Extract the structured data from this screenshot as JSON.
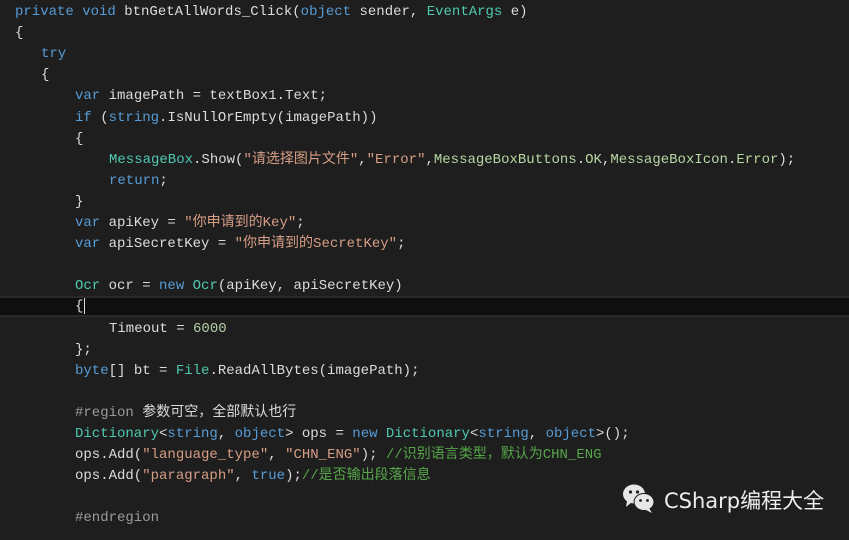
{
  "editor": {
    "current_line_index": 14,
    "lines": [
      {
        "indent": 0,
        "tokens": [
          [
            "kw",
            "private"
          ],
          [
            "plain",
            " "
          ],
          [
            "kw",
            "void"
          ],
          [
            "plain",
            " btnGetAllWords_Click("
          ],
          [
            "kw",
            "object"
          ],
          [
            "plain",
            " sender, "
          ],
          [
            "type",
            "EventArgs"
          ],
          [
            "plain",
            " e)"
          ]
        ]
      },
      {
        "indent": 0,
        "tokens": [
          [
            "plain",
            "{"
          ]
        ]
      },
      {
        "indent": 1,
        "tokens": [
          [
            "kw",
            "try"
          ]
        ]
      },
      {
        "indent": 1,
        "tokens": [
          [
            "plain",
            "{"
          ]
        ]
      },
      {
        "indent": 2,
        "tokens": [
          [
            "kw",
            "var"
          ],
          [
            "plain",
            " imagePath = textBox1.Text;"
          ]
        ]
      },
      {
        "indent": 2,
        "tokens": [
          [
            "kw",
            "if"
          ],
          [
            "plain",
            " ("
          ],
          [
            "kw",
            "string"
          ],
          [
            "plain",
            ".IsNullOrEmpty(imagePath))"
          ]
        ]
      },
      {
        "indent": 2,
        "tokens": [
          [
            "plain",
            "{"
          ]
        ]
      },
      {
        "indent": 3,
        "tokens": [
          [
            "type",
            "MessageBox"
          ],
          [
            "plain",
            ".Show("
          ],
          [
            "str",
            "\"请选择图片文件\""
          ],
          [
            "plain",
            ","
          ],
          [
            "str",
            "\"Error\""
          ],
          [
            "plain",
            ","
          ],
          [
            "enum",
            "MessageBoxButtons"
          ],
          [
            "plain",
            "."
          ],
          [
            "enum",
            "OK"
          ],
          [
            "plain",
            ","
          ],
          [
            "enum",
            "MessageBoxIcon"
          ],
          [
            "plain",
            "."
          ],
          [
            "enum",
            "Error"
          ],
          [
            "plain",
            ");"
          ]
        ]
      },
      {
        "indent": 3,
        "tokens": [
          [
            "kw",
            "return"
          ],
          [
            "plain",
            ";"
          ]
        ]
      },
      {
        "indent": 2,
        "tokens": [
          [
            "plain",
            "}"
          ]
        ]
      },
      {
        "indent": 2,
        "tokens": [
          [
            "kw",
            "var"
          ],
          [
            "plain",
            " apiKey = "
          ],
          [
            "str",
            "\"你申请到的Key\""
          ],
          [
            "plain",
            ";"
          ]
        ]
      },
      {
        "indent": 2,
        "tokens": [
          [
            "kw",
            "var"
          ],
          [
            "plain",
            " apiSecretKey = "
          ],
          [
            "str",
            "\"你申请到的SecretKey\""
          ],
          [
            "plain",
            ";"
          ]
        ]
      },
      {
        "indent": 2,
        "tokens": []
      },
      {
        "indent": 2,
        "tokens": [
          [
            "type",
            "Ocr"
          ],
          [
            "plain",
            " ocr = "
          ],
          [
            "kw",
            "new"
          ],
          [
            "plain",
            " "
          ],
          [
            "type",
            "Ocr"
          ],
          [
            "plain",
            "(apiKey, apiSecretKey)"
          ]
        ]
      },
      {
        "indent": 2,
        "tokens": [
          [
            "plain",
            "{"
          ]
        ],
        "caret": true
      },
      {
        "indent": 3,
        "tokens": [
          [
            "plain",
            "Timeout = "
          ],
          [
            "num",
            "6000"
          ]
        ]
      },
      {
        "indent": 2,
        "tokens": [
          [
            "plain",
            "};"
          ]
        ]
      },
      {
        "indent": 2,
        "tokens": [
          [
            "kw",
            "byte"
          ],
          [
            "plain",
            "[] bt = "
          ],
          [
            "type",
            "File"
          ],
          [
            "plain",
            ".ReadAllBytes(imagePath);"
          ]
        ]
      },
      {
        "indent": 2,
        "tokens": []
      },
      {
        "indent": 2,
        "tokens": [
          [
            "pre",
            "#region"
          ],
          [
            "plain",
            " 参数可空，全部默认也行"
          ]
        ]
      },
      {
        "indent": 2,
        "tokens": [
          [
            "type",
            "Dictionary"
          ],
          [
            "plain",
            "<"
          ],
          [
            "kw",
            "string"
          ],
          [
            "plain",
            ", "
          ],
          [
            "kw",
            "object"
          ],
          [
            "plain",
            "> ops = "
          ],
          [
            "kw",
            "new"
          ],
          [
            "plain",
            " "
          ],
          [
            "type",
            "Dictionary"
          ],
          [
            "plain",
            "<"
          ],
          [
            "kw",
            "string"
          ],
          [
            "plain",
            ", "
          ],
          [
            "kw",
            "object"
          ],
          [
            "plain",
            ">();"
          ]
        ]
      },
      {
        "indent": 2,
        "tokens": [
          [
            "plain",
            "ops.Add("
          ],
          [
            "str",
            "\"language_type\""
          ],
          [
            "plain",
            ", "
          ],
          [
            "str",
            "\"CHN_ENG\""
          ],
          [
            "plain",
            "); "
          ],
          [
            "cmt",
            "//识别语言类型，默认为CHN_ENG"
          ]
        ]
      },
      {
        "indent": 2,
        "tokens": [
          [
            "plain",
            "ops.Add("
          ],
          [
            "str",
            "\"paragraph\""
          ],
          [
            "plain",
            ", "
          ],
          [
            "kw",
            "true"
          ],
          [
            "plain",
            ");"
          ],
          [
            "cmt",
            "//是否输出段落信息"
          ]
        ]
      },
      {
        "indent": 2,
        "tokens": []
      },
      {
        "indent": 2,
        "tokens": [
          [
            "pre",
            "#endregion"
          ]
        ]
      }
    ]
  },
  "watermark": {
    "icon": "wechat-icon",
    "text": "CSharp编程大全"
  },
  "colors": {
    "background": "#1e1e1e",
    "keyword": "#569cd6",
    "type": "#4ec9b0",
    "string": "#d69d85",
    "number": "#b5cea8",
    "comment": "#57a64a",
    "enum_member": "#b8d7a3",
    "preprocessor": "#9b9b9b",
    "plain": "#dcdcdc"
  }
}
